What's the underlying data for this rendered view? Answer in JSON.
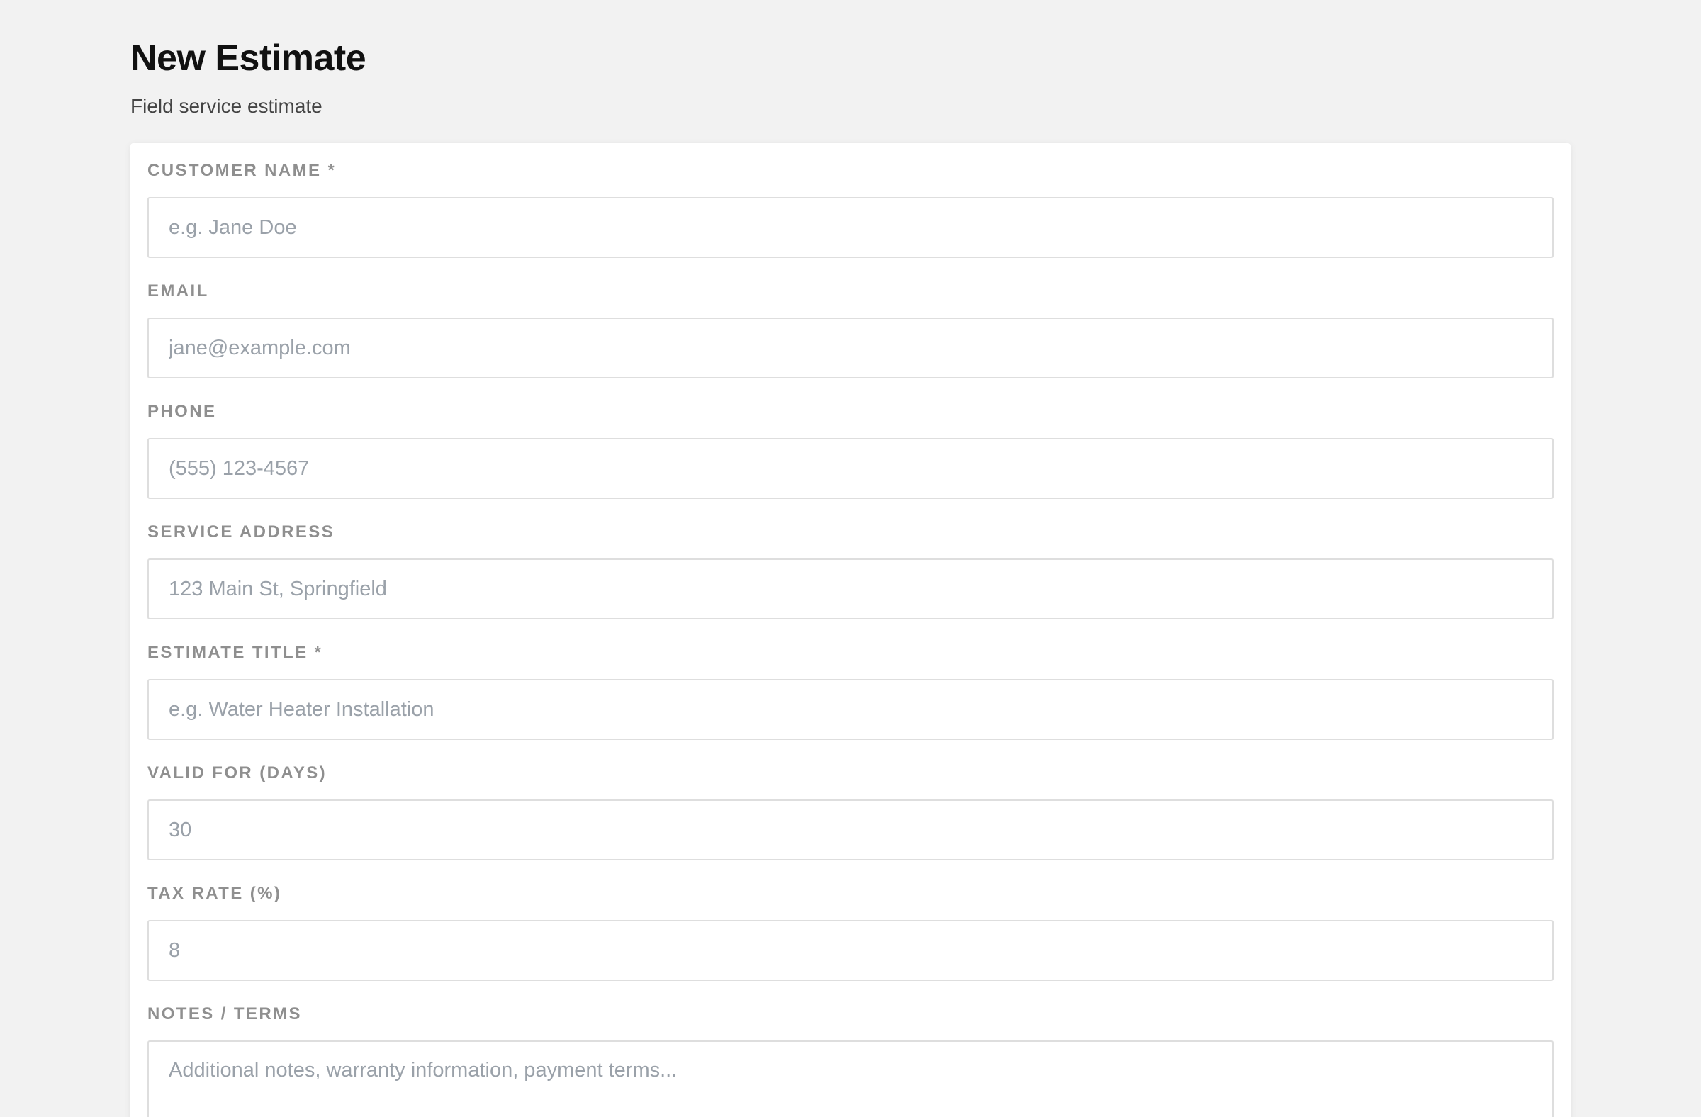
{
  "header": {
    "title": "New Estimate",
    "subtitle": "Field service estimate"
  },
  "form": {
    "customer_name": {
      "label": "CUSTOMER NAME *",
      "placeholder": "e.g. Jane Doe",
      "value": ""
    },
    "email": {
      "label": "EMAIL",
      "placeholder": "jane@example.com",
      "value": ""
    },
    "phone": {
      "label": "PHONE",
      "placeholder": "(555) 123-4567",
      "value": ""
    },
    "service_address": {
      "label": "SERVICE ADDRESS",
      "placeholder": "123 Main St, Springfield",
      "value": ""
    },
    "estimate_title": {
      "label": "ESTIMATE TITLE *",
      "placeholder": "e.g. Water Heater Installation",
      "value": ""
    },
    "valid_for_days": {
      "label": "VALID FOR (DAYS)",
      "placeholder": "30",
      "value": ""
    },
    "tax_rate": {
      "label": "TAX RATE (%)",
      "placeholder": "8",
      "value": ""
    },
    "notes_terms": {
      "label": "NOTES / TERMS",
      "placeholder": "Additional notes, warranty information, payment terms...",
      "value": ""
    }
  },
  "colors": {
    "background": "#f2f2f2",
    "card": "#ffffff",
    "label": "#8f8f8f",
    "placeholder": "#9aa1a9",
    "border": "#dedede",
    "title": "#111111"
  }
}
